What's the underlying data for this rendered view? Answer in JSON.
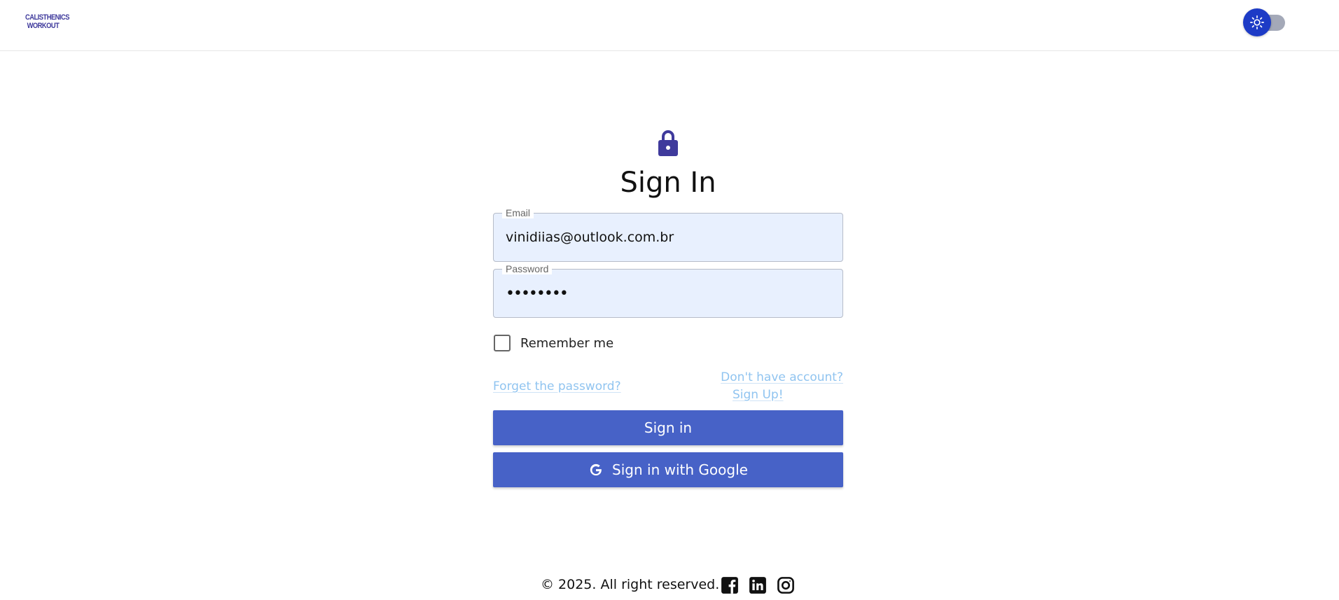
{
  "header": {
    "logo_line1": "CALISTHENICS",
    "logo_line2": "WORKOUT",
    "theme_toggle_icon": "sun-icon"
  },
  "form": {
    "lock_icon": "lock-icon",
    "title": "Sign In",
    "email": {
      "label": "Email",
      "value": "vinidiias@outlook.com.br"
    },
    "password": {
      "label": "Password",
      "value": "••••••••"
    },
    "remember_label": "Remember me",
    "remember_checked": false,
    "forgot_link": "Forget the password?",
    "signup_link_line1": "Don't have account?",
    "signup_link_line2": "Sign Up!",
    "signin_button": "Sign in",
    "google_button": "Sign in with Google"
  },
  "footer": {
    "copyright": "© 2025. All right reserved.",
    "social": [
      "facebook-icon",
      "linkedin-icon",
      "instagram-icon"
    ]
  },
  "colors": {
    "brand": "#3f3a9c",
    "primary_button": "#4762c7",
    "toggle_knob": "#1d3bc6",
    "link": "#90c4f0",
    "input_bg": "#e8f0fe"
  }
}
